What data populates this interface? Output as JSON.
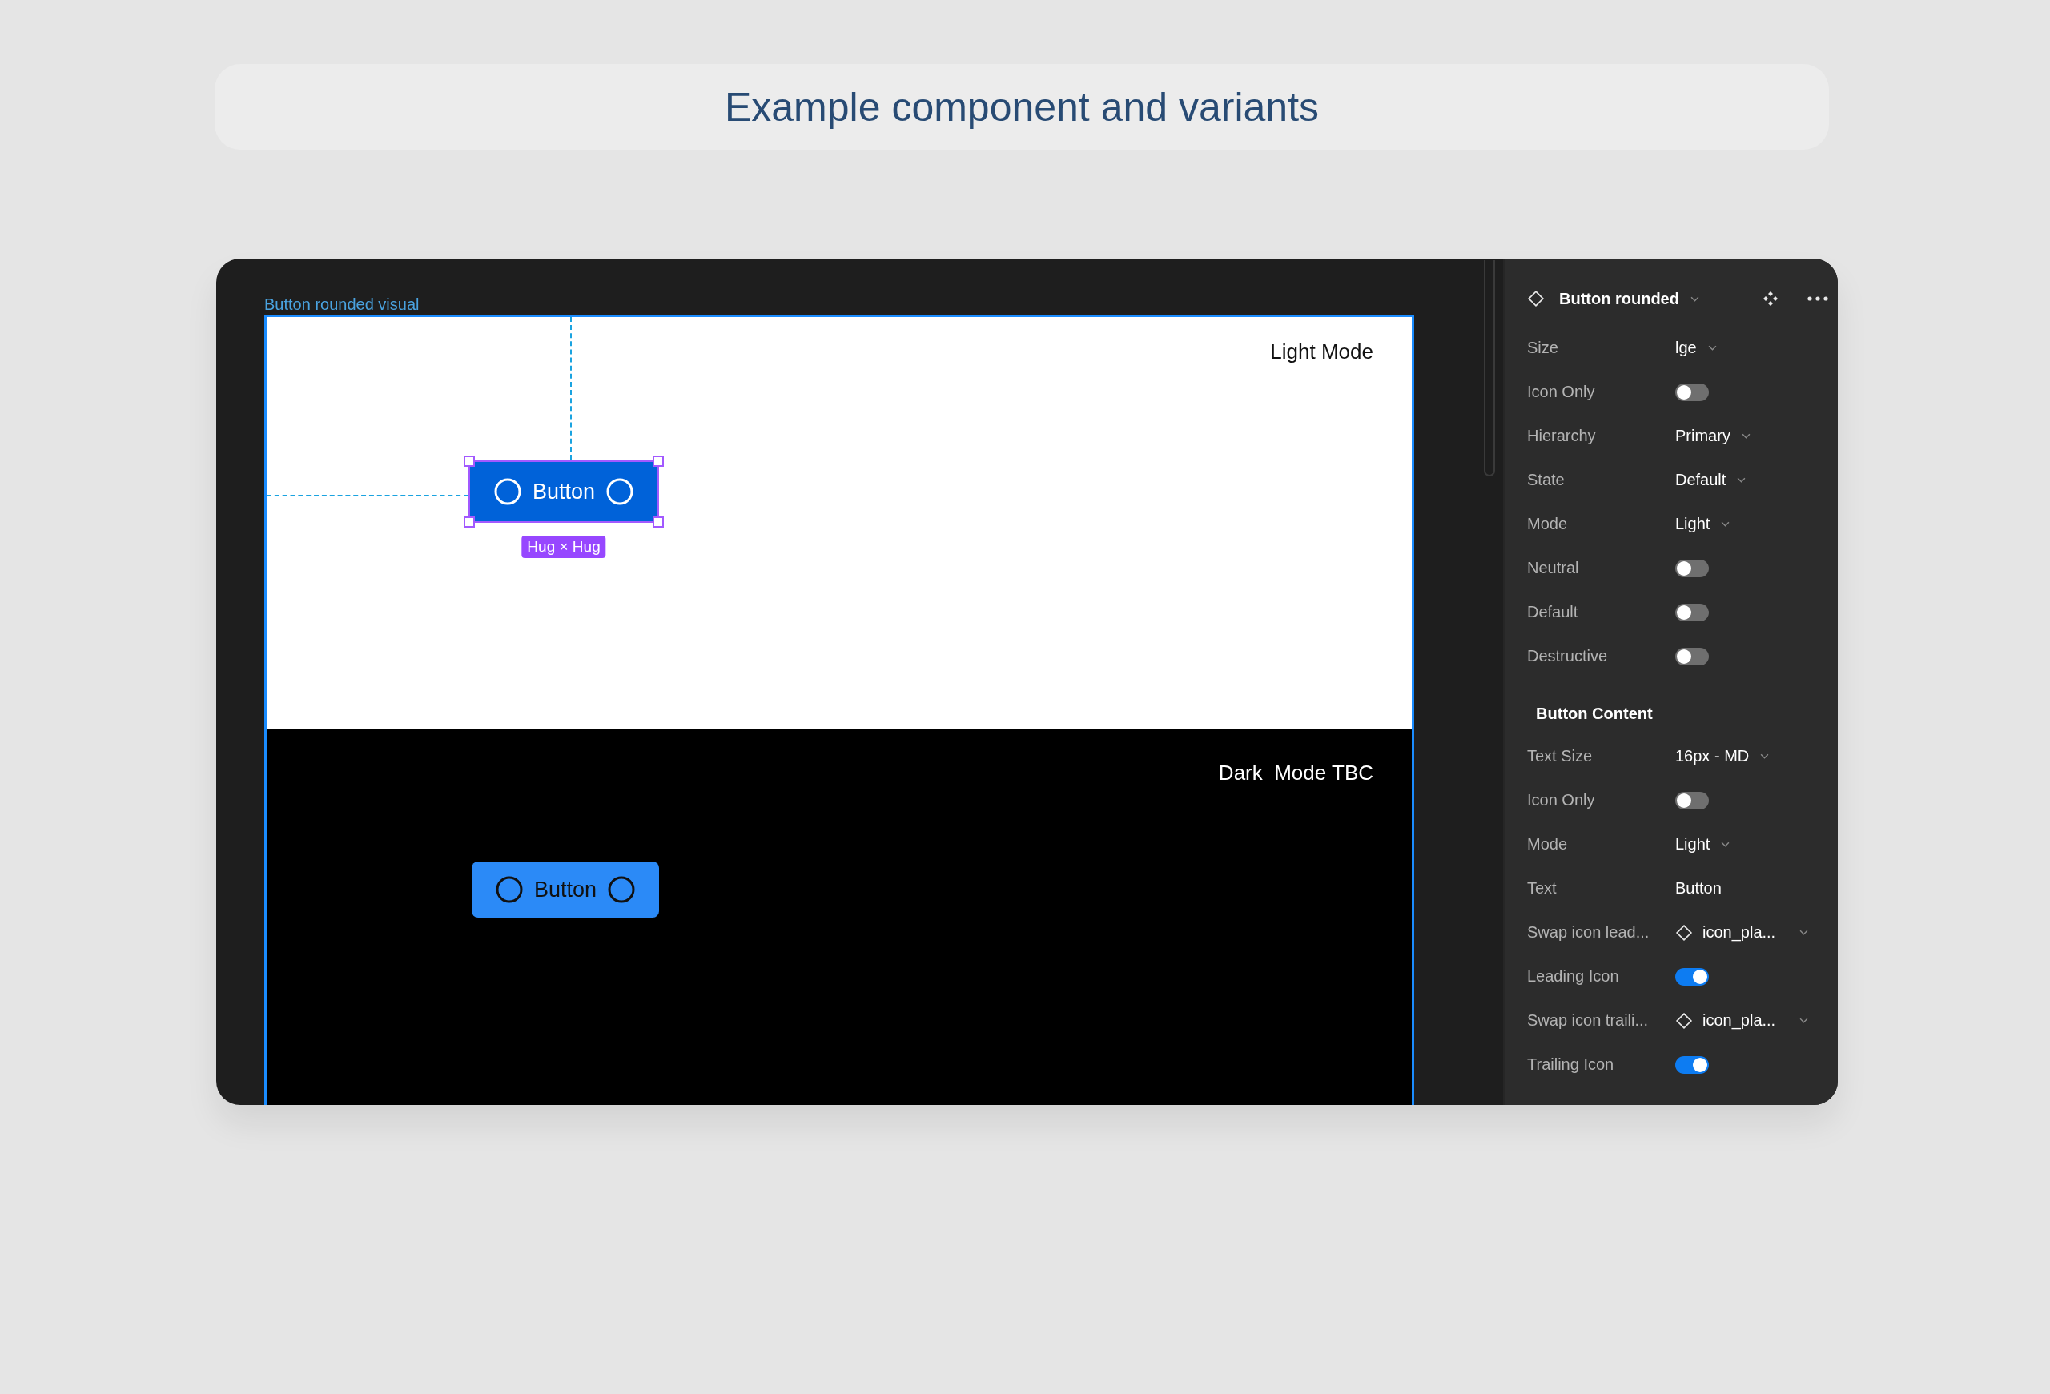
{
  "header": {
    "title": "Example component and variants"
  },
  "canvas": {
    "frame_label": "Button rounded visual",
    "sections": [
      {
        "kind": "light",
        "label": "Light Mode",
        "button": {
          "text": "Button",
          "selected": true,
          "size_tag": "Hug × Hug"
        }
      },
      {
        "kind": "dark",
        "label": "Dark  Mode TBC",
        "button": {
          "text": "Button",
          "selected": false
        }
      }
    ]
  },
  "panel": {
    "title": "Button rounded",
    "groups": [
      {
        "properties": [
          {
            "kind": "dropdown",
            "label": "Size",
            "value": "lge"
          },
          {
            "kind": "toggle",
            "label": "Icon Only",
            "on": false
          },
          {
            "kind": "dropdown",
            "label": "Hierarchy",
            "value": "Primary"
          },
          {
            "kind": "dropdown",
            "label": "State",
            "value": "Default"
          },
          {
            "kind": "dropdown",
            "label": "Mode",
            "value": "Light"
          },
          {
            "kind": "toggle",
            "label": "Neutral",
            "on": false
          },
          {
            "kind": "toggle",
            "label": "Default",
            "on": false
          },
          {
            "kind": "toggle",
            "label": "Destructive",
            "on": false
          }
        ]
      },
      {
        "title": "_Button Content",
        "properties": [
          {
            "kind": "dropdown",
            "label": "Text Size",
            "value": "16px - MD"
          },
          {
            "kind": "toggle",
            "label": "Icon Only",
            "on": false
          },
          {
            "kind": "dropdown",
            "label": "Mode",
            "value": "Light"
          },
          {
            "kind": "text",
            "label": "Text",
            "value": "Button"
          },
          {
            "kind": "instance",
            "label": "Swap icon lead...",
            "value": "icon_pla..."
          },
          {
            "kind": "toggle",
            "label": "Leading Icon",
            "on": true
          },
          {
            "kind": "instance",
            "label": "Swap icon traili...",
            "value": "icon_pla..."
          },
          {
            "kind": "toggle",
            "label": "Trailing Icon",
            "on": true
          }
        ]
      }
    ]
  }
}
